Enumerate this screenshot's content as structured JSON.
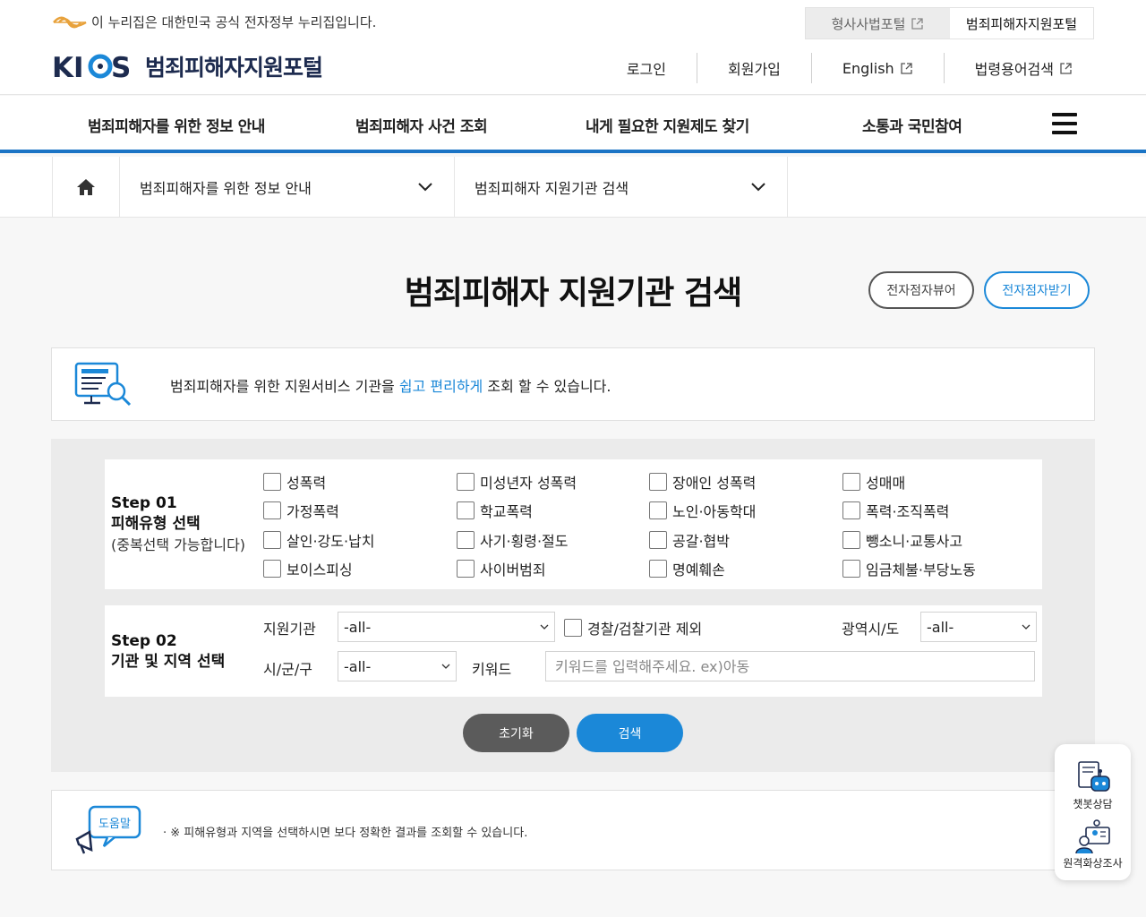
{
  "top": {
    "gov_notice": "이 누리집은 대한민국 공식 전자정부 누리집입니다.",
    "portal_tabs": [
      "형사사법포털",
      "범죄피해자지원포털"
    ]
  },
  "header": {
    "logo_text": "범죄피해자지원포털",
    "util_links": [
      "로그인",
      "회원가입",
      "English",
      "법령용어검색"
    ]
  },
  "gnb": {
    "items": [
      "범죄피해자를 위한 정보 안내",
      "범죄피해자 사건 조회",
      "내게 필요한 지원제도 찾기",
      "소통과 국민참여"
    ]
  },
  "breadcrumb": {
    "level1": "범죄피해자를 위한 정보 안내",
    "level2": "범죄피해자 지원기관 검색"
  },
  "page": {
    "title": "범죄피해자 지원기관 검색",
    "viewer_button": "전자점자뷰어",
    "download_button": "전자점자받기"
  },
  "intro": {
    "text_before": "범죄피해자를 위한 지원서비스 기관을 ",
    "highlight": "쉽고 편리하게",
    "text_after": " 조회 할 수 있습니다."
  },
  "step1": {
    "step": "Step 01",
    "title": "피해유형 선택",
    "note": "(중복선택 가능합니다)",
    "options": [
      "성폭력",
      "미성년자 성폭력",
      "장애인 성폭력",
      "성매매",
      "가정폭력",
      "학교폭력",
      "노인·아동학대",
      "폭력·조직폭력",
      "살인·강도·납치",
      "사기·횡령·절도",
      "공갈·협박",
      "뺑소니·교통사고",
      "보이스피싱",
      "사이버범죄",
      "명예훼손",
      "임금체불·부당노동"
    ]
  },
  "step2": {
    "step": "Step 02",
    "title": "기관 및 지역 선택",
    "agency_label": "지원기관",
    "agency_value": "-all-",
    "exclude_label": "경찰/검찰기관 제외",
    "region_label": "광역시/도",
    "region_value": "-all-",
    "district_label": "시/군/구",
    "district_value": "-all-",
    "keyword_label": "키워드",
    "keyword_placeholder": "키워드를 입력해주세요. ex)아동"
  },
  "buttons": {
    "reset": "초기화",
    "search": "검색"
  },
  "help": {
    "badge": "도움말",
    "text": "· ※ 피해유형과 지역을 선택하시면 보다 정확한 결과를 조회할 수 있습니다."
  },
  "quick_menu": {
    "chatbot": "챗봇상담",
    "video": "원격화상조사"
  },
  "colors": {
    "accent": "#1b88d8",
    "gnb_border": "#1b74c5",
    "logo_navy": "#1d2b4f"
  }
}
